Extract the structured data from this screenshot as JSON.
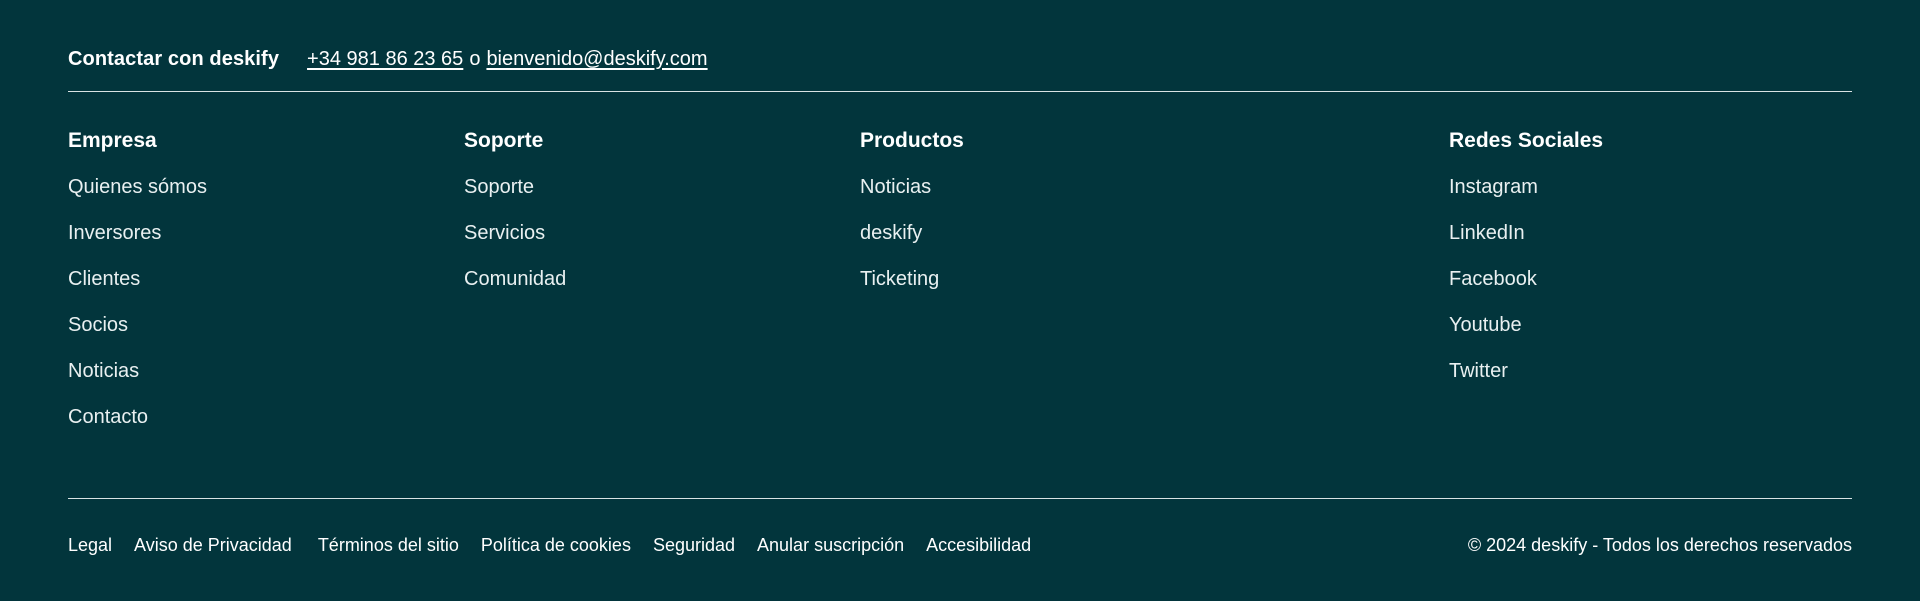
{
  "contact": {
    "title": "Contactar con deskify",
    "phone": "+34 981 86 23 65",
    "separator": "o",
    "email": "bienvenido@deskify.com"
  },
  "columns": {
    "empresa": {
      "title": "Empresa",
      "items": [
        "Quienes sómos",
        "Inversores",
        "Clientes",
        "Socios",
        "Noticias",
        "Contacto"
      ]
    },
    "soporte": {
      "title": "Soporte",
      "items": [
        "Soporte",
        "Servicios",
        "Comunidad"
      ]
    },
    "productos": {
      "title": "Productos",
      "items": [
        "Noticias",
        "deskify",
        "Ticketing"
      ]
    },
    "redes": {
      "title": "Redes Sociales",
      "items": [
        "Instagram",
        "LinkedIn",
        "Facebook",
        "Youtube",
        "Twitter"
      ]
    }
  },
  "bottom": {
    "links": [
      "Legal",
      "Aviso de Privacidad",
      "Términos del sitio",
      "Política de cookies",
      "Seguridad",
      "Anular suscripción",
      "Accesibilidad"
    ],
    "copyright": "© 2024 deskify - Todos los derechos reservados"
  },
  "colors": {
    "background": "#02353c",
    "text": "#ffffff",
    "divider": "#d9e3e4"
  }
}
